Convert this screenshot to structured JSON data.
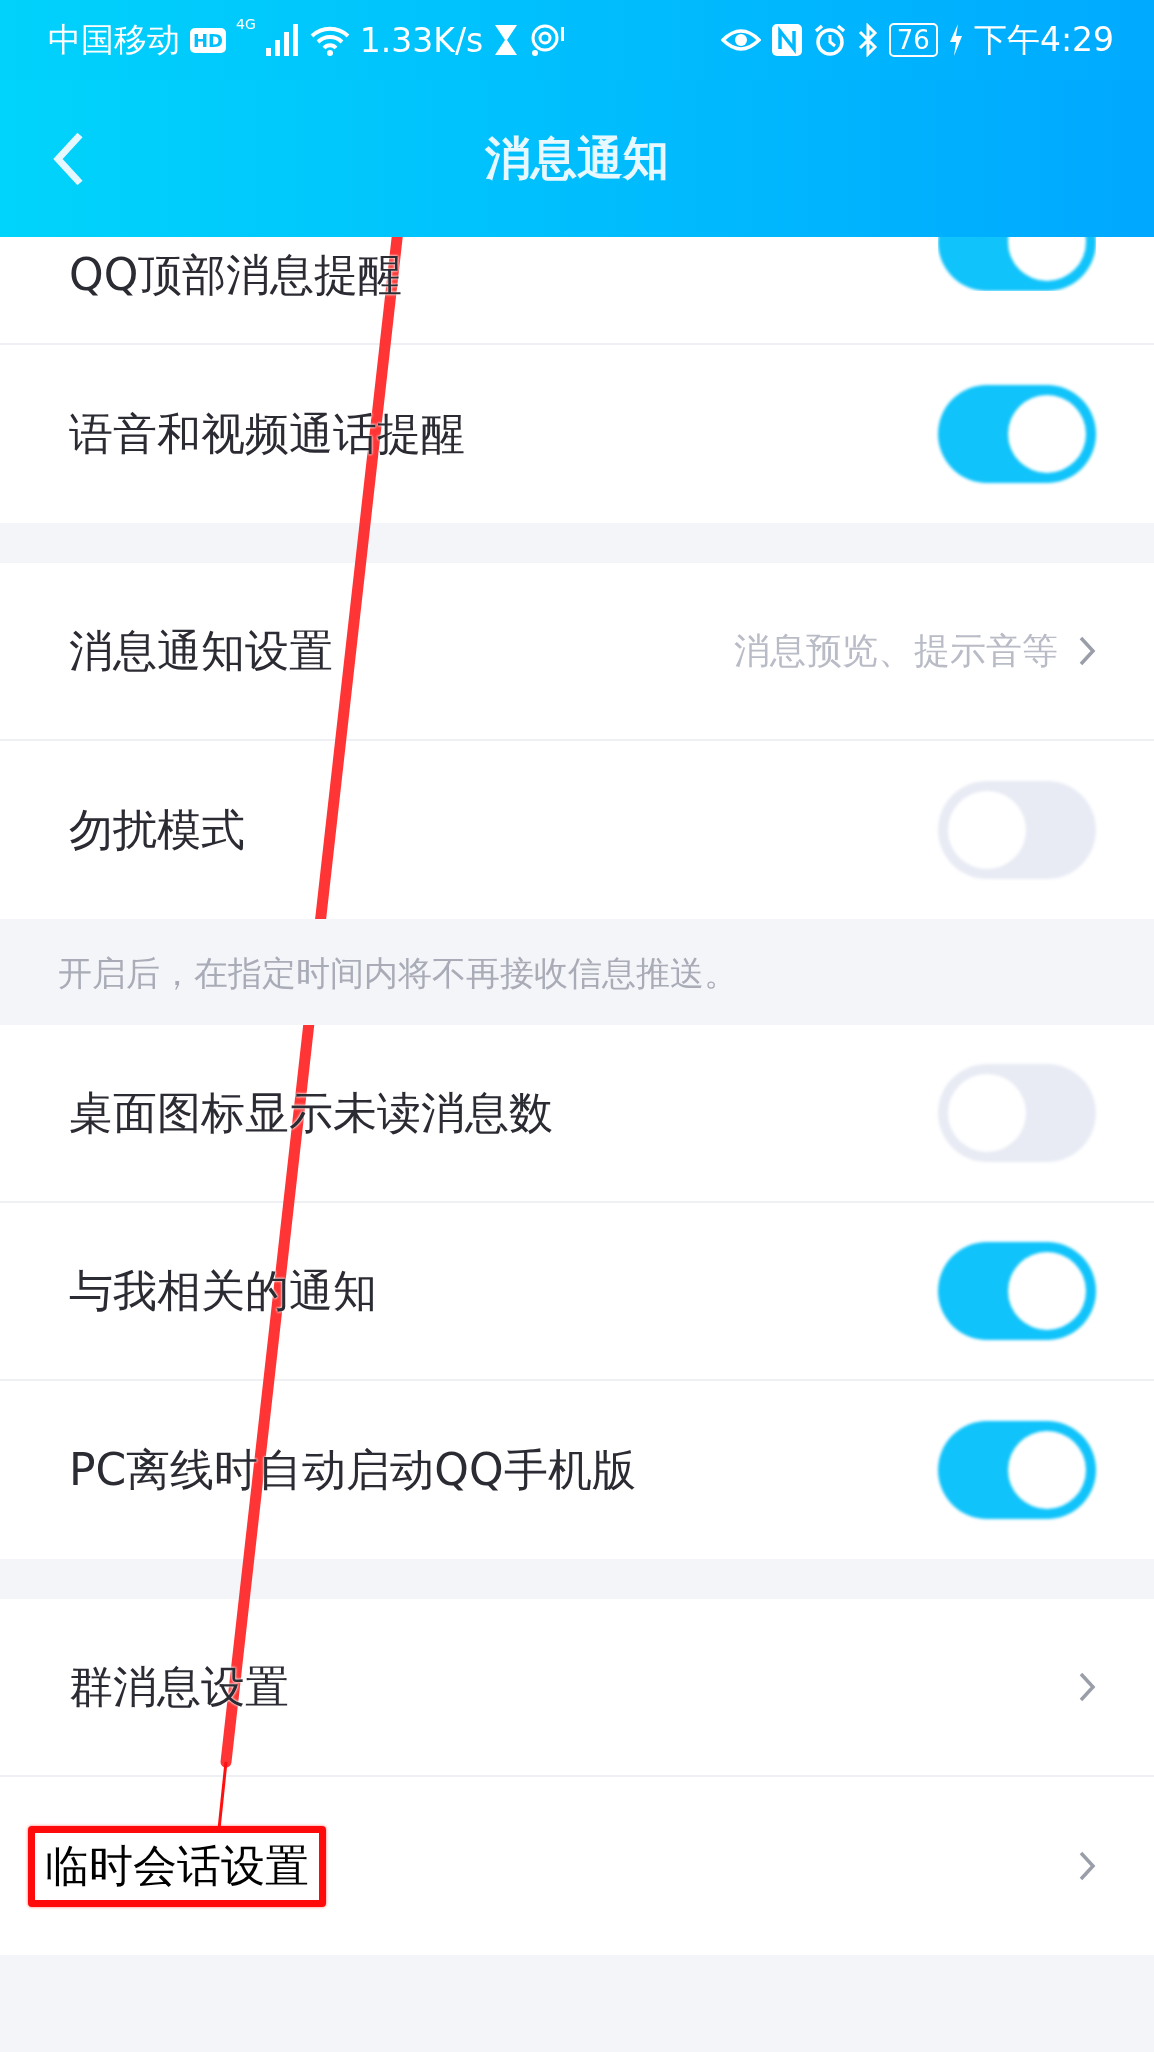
{
  "status_bar": {
    "carrier": "中国移动",
    "hd": "HD",
    "network": "4G",
    "speed": "1.33K/s",
    "battery": "76",
    "time": "下午4:29"
  },
  "header": {
    "title": "消息通知"
  },
  "sections": [
    {
      "rows": [
        {
          "kind": "toggle",
          "label": "QQ顶部消息提醒",
          "on": true
        },
        {
          "kind": "toggle",
          "label": "语音和视频通话提醒",
          "on": true
        }
      ]
    },
    {
      "rows": [
        {
          "kind": "link",
          "label": "消息通知设置",
          "value": "消息预览、提示音等"
        },
        {
          "kind": "toggle",
          "label": "勿扰模式",
          "on": false
        }
      ],
      "note": "开启后，在指定时间内将不再接收信息推送。"
    },
    {
      "rows": [
        {
          "kind": "toggle",
          "label": "桌面图标显示未读消息数",
          "on": false
        },
        {
          "kind": "toggle",
          "label": "与我相关的通知",
          "on": true
        },
        {
          "kind": "toggle",
          "label": "PC离线时自动启动QQ手机版",
          "on": true
        }
      ]
    },
    {
      "rows": [
        {
          "kind": "link",
          "label": "群消息设置",
          "highlighted": false
        },
        {
          "kind": "link",
          "label": "临时会话设置",
          "highlighted": true
        }
      ]
    }
  ]
}
